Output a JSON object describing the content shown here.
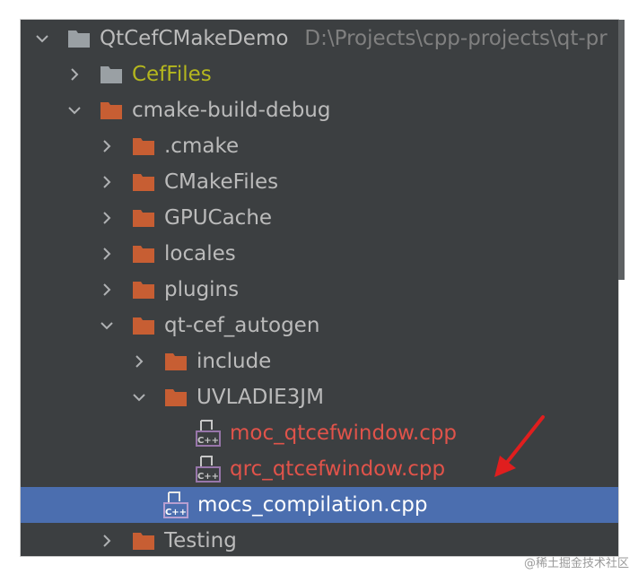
{
  "colors": {
    "panel_bg": "#3c3f41",
    "selection_bg": "#4b6eaf",
    "folder_orange": "#c75e33",
    "folder_gray": "#9aa0a4",
    "text_default": "#bbbbbb",
    "text_excluded": "#b5b71e",
    "text_modified": "#e0534a",
    "annotation_arrow": "#e01e1e"
  },
  "tree": {
    "root": {
      "name": "QtCefCMakeDemo",
      "path": "D:\\Projects\\cpp-projects\\qt-pr",
      "icon": "folder-icon",
      "expanded": true
    },
    "cef_files": {
      "name": "CefFiles",
      "icon": "folder-icon",
      "expanded": false
    },
    "cmake_build_debug": {
      "name": "cmake-build-debug",
      "icon": "folder-icon",
      "expanded": true
    },
    "dot_cmake": {
      "name": ".cmake",
      "icon": "folder-icon",
      "expanded": false
    },
    "cmake_files": {
      "name": "CMakeFiles",
      "icon": "folder-icon",
      "expanded": false
    },
    "gpu_cache": {
      "name": "GPUCache",
      "icon": "folder-icon",
      "expanded": false
    },
    "locales": {
      "name": "locales",
      "icon": "folder-icon",
      "expanded": false
    },
    "plugins": {
      "name": "plugins",
      "icon": "folder-icon",
      "expanded": false
    },
    "qt_cef_autogen": {
      "name": "qt-cef_autogen",
      "icon": "folder-icon",
      "expanded": true
    },
    "include": {
      "name": "include",
      "icon": "folder-icon",
      "expanded": false
    },
    "uvladie3jm": {
      "name": "UVLADIE3JM",
      "icon": "folder-icon",
      "expanded": true
    },
    "moc_file": {
      "name": "moc_qtcefwindow.cpp",
      "icon": "cpp-file-icon"
    },
    "qrc_file": {
      "name": "qrc_qtcefwindow.cpp",
      "icon": "cpp-file-icon"
    },
    "mocs_file": {
      "name": "mocs_compilation.cpp",
      "icon": "cpp-file-icon",
      "selected": true
    },
    "testing": {
      "name": "Testing",
      "icon": "folder-icon",
      "expanded": false
    }
  },
  "watermark": "@稀土掘金技术社区"
}
